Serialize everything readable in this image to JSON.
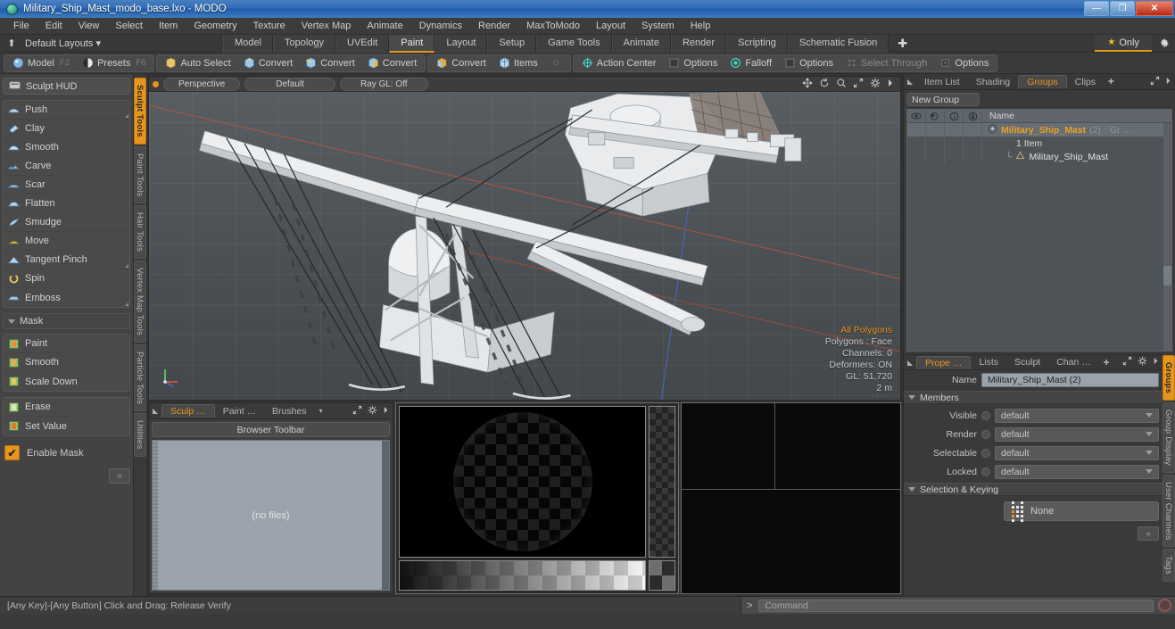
{
  "window": {
    "title": "Military_Ship_Mast_modo_base.lxo - MODO",
    "app_icon": "modo-globe-icon",
    "minimize": "—",
    "maximize": "❐",
    "close": "✕"
  },
  "menubar": {
    "items": [
      "File",
      "Edit",
      "View",
      "Select",
      "Item",
      "Geometry",
      "Texture",
      "Vertex Map",
      "Animate",
      "Dynamics",
      "Render",
      "MaxToModo",
      "Layout",
      "System",
      "Help"
    ]
  },
  "layoutbar": {
    "default_layouts": "Default Layouts ▾",
    "tabs": [
      {
        "label": "Model",
        "active": false
      },
      {
        "label": "Topology",
        "active": false
      },
      {
        "label": "UVEdit",
        "active": false
      },
      {
        "label": "Paint",
        "active": true
      },
      {
        "label": "Layout",
        "active": false
      },
      {
        "label": "Setup",
        "active": false
      },
      {
        "label": "Game Tools",
        "active": false
      },
      {
        "label": "Animate",
        "active": false
      },
      {
        "label": "Render",
        "active": false
      },
      {
        "label": "Scripting",
        "active": false
      },
      {
        "label": "Schematic Fusion",
        "active": false
      }
    ],
    "plus": "✚",
    "only_label": "Only",
    "star": "★"
  },
  "modebar": {
    "groups": [
      {
        "items": [
          {
            "label": "Model",
            "icon": "sphere-blue-icon",
            "key": "F2",
            "dim": false
          },
          {
            "label": "Presets",
            "icon": "sphere-half-icon",
            "key": "F6",
            "dim": false
          }
        ]
      },
      {
        "items": [
          {
            "label": "Auto Select",
            "icon": "cube-yellow-icon",
            "key": "",
            "dim": false
          },
          {
            "label": "Convert",
            "icon": "cube-vertex-icon",
            "key": "",
            "dim": false
          },
          {
            "label": "Convert",
            "icon": "cube-edge-icon",
            "key": "",
            "dim": false
          },
          {
            "label": "Convert",
            "icon": "cube-poly-icon",
            "key": "",
            "dim": false
          }
        ]
      },
      {
        "items": [
          {
            "label": "Convert",
            "icon": "cube-item-icon",
            "key": "",
            "dim": false
          },
          {
            "label": "Items",
            "icon": "items-icon",
            "key": "",
            "dim": false
          },
          {
            "label": "",
            "icon": "center-icon",
            "key": "",
            "dim": true
          }
        ]
      },
      {
        "items": [
          {
            "label": "Action Center",
            "icon": "crosshair-icon",
            "key": "",
            "dim": false
          },
          {
            "label": "Options",
            "icon": "square-icon",
            "key": "",
            "dim": false
          },
          {
            "label": "Falloff",
            "icon": "falloff-circle-icon",
            "key": "",
            "dim": false
          },
          {
            "label": "Options",
            "icon": "square-icon",
            "key": "",
            "dim": false
          },
          {
            "label": "Select Through",
            "icon": "select-through-icon",
            "key": "",
            "dim": true
          },
          {
            "label": "Options",
            "icon": "square-small-icon",
            "key": "",
            "dim": false
          }
        ]
      }
    ]
  },
  "left_panel": {
    "sculpt_hud": {
      "label": "Sculpt HUD",
      "icon": "hud-icon"
    },
    "sculpt_tools": [
      {
        "label": "Push",
        "icon": "push-brush-icon",
        "corner": true
      },
      {
        "label": "Clay",
        "icon": "clay-brush-icon",
        "corner": false
      },
      {
        "label": "Smooth",
        "icon": "smooth-brush-icon",
        "corner": false
      },
      {
        "label": "Carve",
        "icon": "carve-brush-icon",
        "corner": false
      },
      {
        "label": "Scar",
        "icon": "scar-brush-icon",
        "corner": false
      },
      {
        "label": "Flatten",
        "icon": "flatten-brush-icon",
        "corner": false
      },
      {
        "label": "Smudge",
        "icon": "smudge-brush-icon",
        "corner": false
      },
      {
        "label": "Move",
        "icon": "move-brush-icon",
        "corner": false
      },
      {
        "label": "Tangent Pinch",
        "icon": "pinch-brush-icon",
        "corner": true
      },
      {
        "label": "Spin",
        "icon": "spin-brush-icon",
        "corner": false
      },
      {
        "label": "Emboss",
        "icon": "emboss-brush-icon",
        "corner": true
      }
    ],
    "mask_section": "Mask",
    "mask_tools": [
      {
        "label": "Paint",
        "icon": "mask-paint-icon"
      },
      {
        "label": "Smooth",
        "icon": "mask-smooth-icon"
      },
      {
        "label": "Scale Down",
        "icon": "mask-scale-icon"
      }
    ],
    "mask_tools2": [
      {
        "label": "Erase",
        "icon": "mask-erase-icon"
      },
      {
        "label": "Set Value",
        "icon": "mask-setvalue-icon"
      }
    ],
    "enable_mask": {
      "label": "Enable Mask",
      "checked": true,
      "check_glyph": "✔"
    },
    "expand": "»",
    "vtabs": [
      {
        "label": "Sculpt Tools",
        "active": true
      },
      {
        "label": "Paint Tools",
        "active": false
      },
      {
        "label": "Hair Tools",
        "active": false
      },
      {
        "label": "Vertex Map Tools",
        "active": false
      },
      {
        "label": "Particle Tools",
        "active": false
      },
      {
        "label": "Utilities",
        "active": false
      }
    ]
  },
  "viewport": {
    "dot": "•",
    "pills": [
      "Perspective",
      "Default",
      "Ray GL: Off"
    ],
    "icons": [
      "pan-icon",
      "rotate-icon",
      "zoom-icon",
      "fit-icon",
      "gear-icon",
      "chevron-right-icon"
    ],
    "stats": {
      "selection": "All Polygons",
      "polygons": "Polygons : Face",
      "channels": "Channels: 0",
      "deformers": "Deformers: ON",
      "gl": "GL: 51,720",
      "scale": "2 m"
    }
  },
  "browser": {
    "tabs": [
      {
        "label": "Sculp …",
        "active": true
      },
      {
        "label": "Paint …",
        "active": false
      },
      {
        "label": "Brushes",
        "active": false
      }
    ],
    "caret": "▾",
    "icons": [
      "expand-icon",
      "gear-icon",
      "chevron-right-icon"
    ],
    "toolbar_label": "Browser Toolbar",
    "empty_label": "(no files)"
  },
  "right_panel": {
    "top_tabs": [
      {
        "label": "Item List",
        "active": false
      },
      {
        "label": "Shading",
        "active": false
      },
      {
        "label": "Groups",
        "active": true
      },
      {
        "label": "Clips",
        "active": false
      }
    ],
    "top_plus": "✚",
    "top_icons": [
      "expand-icon",
      "chevron-right-icon"
    ],
    "new_group_label": "New Group",
    "list_header": {
      "cols": [
        "eye-icon",
        "render-icon",
        "info-icon",
        "lock-icon"
      ],
      "name": "Name"
    },
    "rows": [
      {
        "name": "Military_Ship_Mast",
        "suffix": "(2)",
        "tail": ": Gr …",
        "icon": "group-icon",
        "selected": true
      },
      {
        "sub": "1 Item"
      },
      {
        "child": "Military_Ship_Mast",
        "icon": "mesh-icon"
      }
    ],
    "prop_tabs": [
      {
        "label": "Prope …",
        "active": true
      },
      {
        "label": "Lists",
        "active": false
      },
      {
        "label": "Sculpt",
        "active": false
      },
      {
        "label": "Chan …",
        "active": false
      }
    ],
    "prop_plus": "✚",
    "prop_icons": [
      "expand-icon",
      "gear-icon",
      "chevron-right-icon"
    ],
    "name_label": "Name",
    "name_value": "Military_Ship_Mast (2)",
    "members_section": "Members",
    "members": [
      {
        "label": "Visible",
        "value": "default"
      },
      {
        "label": "Render",
        "value": "default"
      },
      {
        "label": "Selectable",
        "value": "default"
      },
      {
        "label": "Locked",
        "value": "default"
      }
    ],
    "selection_section": "Selection & Keying",
    "selection_value": "None",
    "selection_icon": "keying-grid-icon",
    "expand": "»",
    "vtabs": [
      {
        "label": "Groups",
        "active": true
      },
      {
        "label": "Group Display",
        "active": false
      },
      {
        "label": "User Channels",
        "active": false
      },
      {
        "label": "Tags",
        "active": false
      }
    ]
  },
  "statusbar": {
    "hint": "[Any Key]-[Any Button] Click and Drag:   Release Verify",
    "prompt": ">",
    "command_placeholder": "Command",
    "record_icon": "record-icon"
  },
  "colors": {
    "accent": "#e8951d",
    "panel": "#3a3a3a",
    "viewport_bg": "#4d5357",
    "axis_red": "#c4533d",
    "axis_blue": "#4a6ad0"
  }
}
